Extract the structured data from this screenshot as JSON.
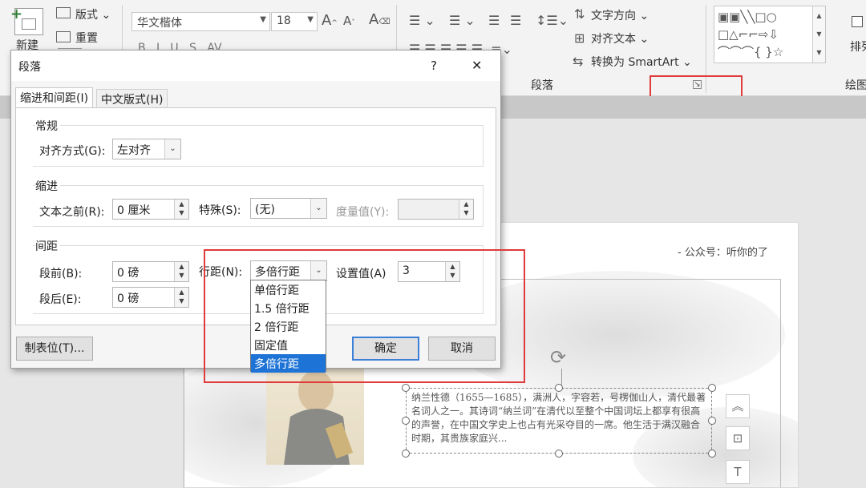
{
  "ribbon": {
    "new_label": "新建",
    "layout_label": "版式",
    "reset_label": "重置",
    "font_name": "华文楷体",
    "font_size": "18",
    "text_direction_label": "文字方向",
    "align_text_label": "对齐文本",
    "smartart_label": "转换为 SmartArt",
    "paragraph_group_label": "段落",
    "arrange_label": "排列",
    "drawing_group_label": "绘图"
  },
  "slide": {
    "header_text": "- 公众号：听你的了",
    "textbox_text": "纳兰性德（1655—1685），满洲人，字容若，号楞伽山人，清代最著名词人之一。其诗词“纳兰词”在清代以至整个中国词坛上都享有很高的声誉，在中国文学史上也占有光采夺目的一席。他生活于满汉融合时期，其贵族家庭兴..."
  },
  "dialog": {
    "title": "段落",
    "help_icon": "?",
    "close_icon": "✕",
    "tabs": [
      {
        "label": "缩进和间距(I)"
      },
      {
        "label": "中文版式(H)"
      }
    ],
    "general": {
      "group_label": "常规",
      "alignment_label": "对齐方式(G):",
      "alignment_value": "左对齐"
    },
    "indent": {
      "group_label": "缩进",
      "before_text_label": "文本之前(R):",
      "before_text_value": "0 厘米",
      "special_label": "特殊(S):",
      "special_value": "(无)",
      "measure_label": "度量值(Y):",
      "measure_value": ""
    },
    "spacing": {
      "group_label": "间距",
      "before_label": "段前(B):",
      "before_value": "0 磅",
      "after_label": "段后(E):",
      "after_value": "0 磅",
      "line_spacing_label": "行距(N):",
      "line_spacing_value": "多倍行距",
      "set_value_label": "设置值(A)",
      "set_value": "3",
      "options": [
        "单倍行距",
        "1.5 倍行距",
        "2 倍行距",
        "固定值",
        "多倍行距"
      ],
      "selected_index": 4
    },
    "tabs_button": "制表位(T)...",
    "ok_button": "确定",
    "cancel_button": "取消"
  },
  "colors": {
    "accent": "#1e73d6",
    "highlight_box": "#e03a3a"
  }
}
